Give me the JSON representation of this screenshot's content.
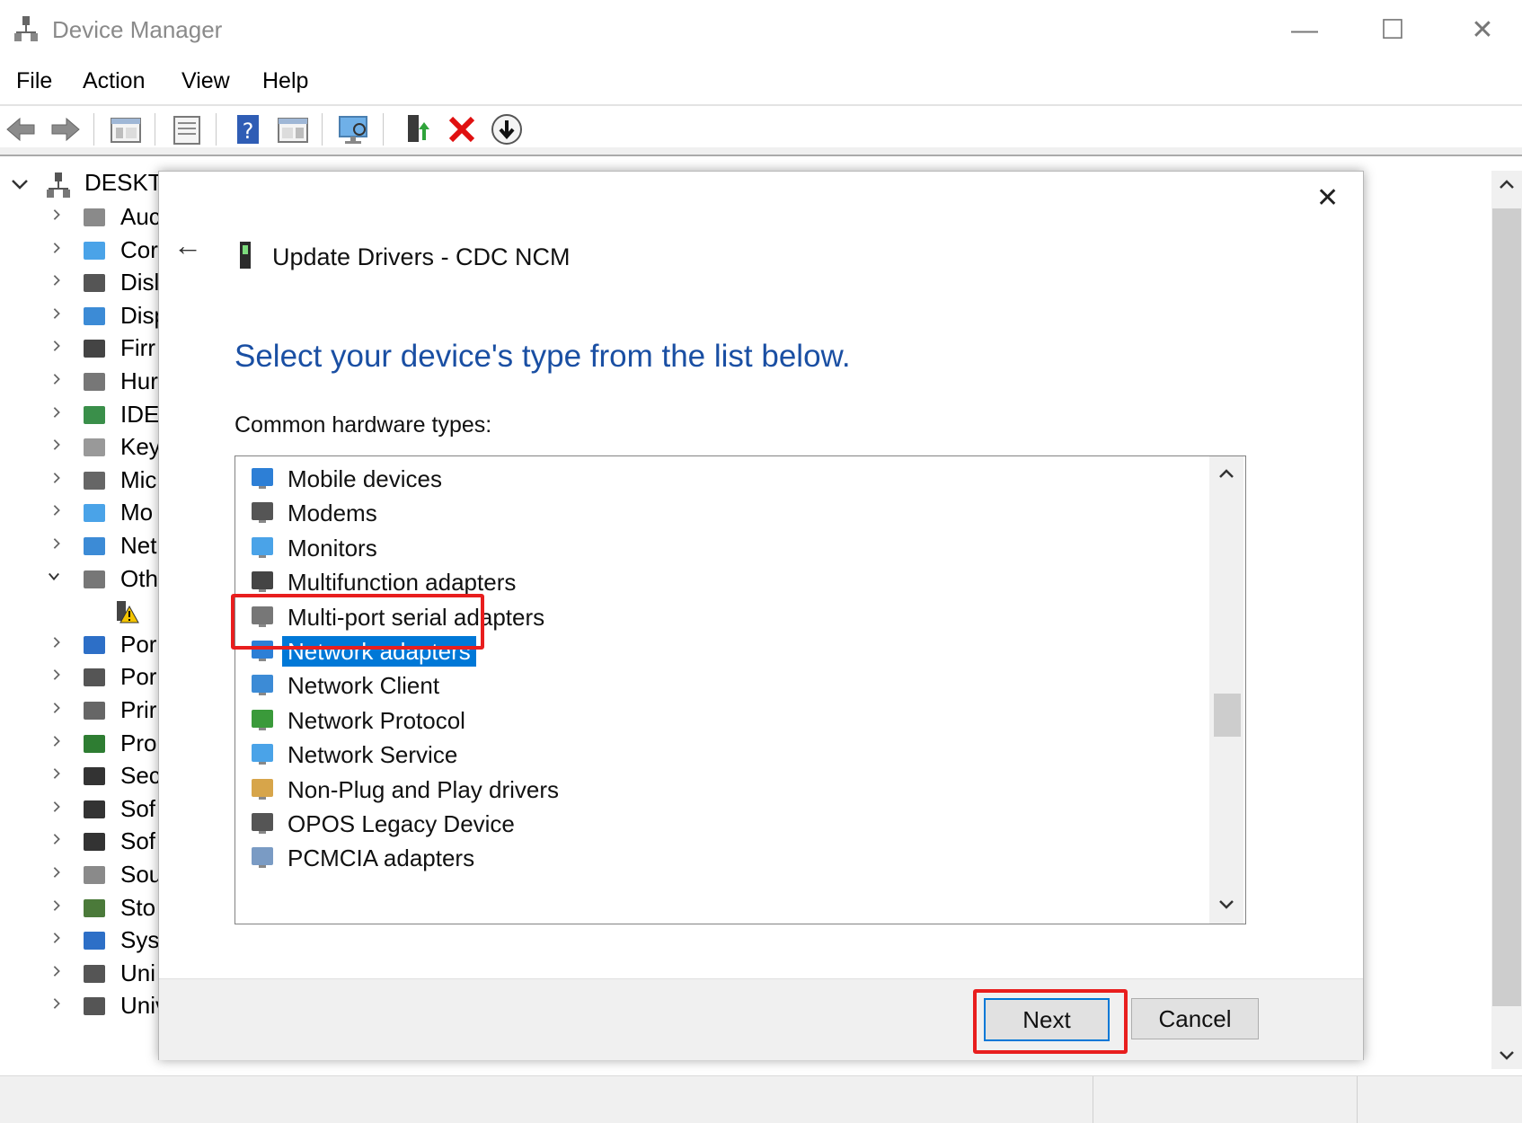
{
  "window": {
    "title": "Device Manager",
    "controls": {
      "minimize": "—",
      "maximize": "☐",
      "close": "✕"
    }
  },
  "menu": [
    "File",
    "Action",
    "View",
    "Help"
  ],
  "tree": {
    "root": "DESKTC",
    "items": [
      "Auc",
      "Cor",
      "Disl",
      "Disp",
      "Firr",
      "Hur",
      "IDE",
      "Key",
      "Mic",
      "Mo",
      "Net",
      "Oth",
      "",
      "Por",
      "Por",
      "Prir",
      "Pro",
      "Sec",
      "Sof",
      "Sof",
      "Sou",
      "Sto",
      "Sys",
      "Uni",
      "Universal Serial Bus devices"
    ]
  },
  "dialog": {
    "title": "Update Drivers - CDC NCM",
    "close": "✕",
    "back": "←",
    "heading": "Select your device's type from the list below.",
    "subheading": "Common hardware types:",
    "list": [
      "Mobile devices",
      "Modems",
      "Monitors",
      "Multifunction adapters",
      "Multi-port serial adapters",
      "Network adapters",
      "Network Client",
      "Network Protocol",
      "Network Service",
      "Non-Plug and Play drivers",
      "OPOS Legacy Device",
      "PCMCIA adapters"
    ],
    "selected": "Network adapters",
    "next_label": "Next",
    "cancel_label": "Cancel"
  },
  "colors": {
    "accent": "#0078d7",
    "heading": "#1a4fa3",
    "highlight": "#e81e1e"
  }
}
